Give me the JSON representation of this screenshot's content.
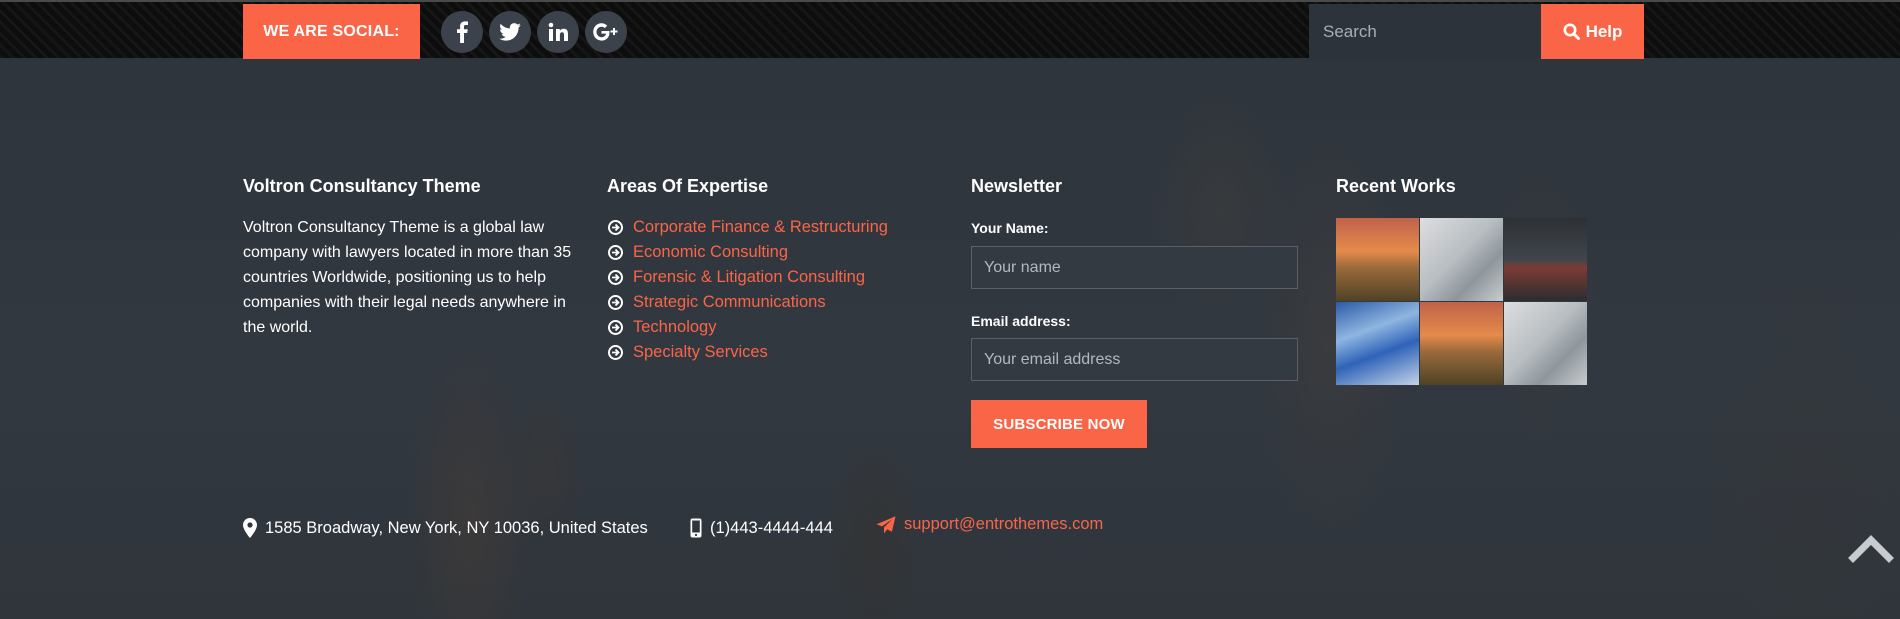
{
  "topbar": {
    "social_label": "WE ARE SOCIAL:",
    "social_links": [
      {
        "name": "facebook-icon",
        "glyph": "f"
      },
      {
        "name": "twitter-icon",
        "glyph": "t"
      },
      {
        "name": "linkedin-icon",
        "glyph": "in"
      },
      {
        "name": "google-plus-icon",
        "glyph": "G+"
      }
    ],
    "search_placeholder": "Search",
    "help_label": "Help"
  },
  "about": {
    "title": "Voltron Consultancy Theme",
    "text": "Voltron Consultancy Theme is a global law company with lawyers located in more than 35 countries Worldwide, positioning us to help companies with their legal needs anywhere in the world."
  },
  "expertise": {
    "title": "Areas Of Expertise",
    "items": [
      "Corporate Finance & Restructuring",
      "Economic Consulting",
      "Forensic & Litigation Consulting",
      "Strategic Communications",
      "Technology",
      "Specialty Services"
    ]
  },
  "newsletter": {
    "title": "Newsletter",
    "name_label": "Your Name:",
    "name_placeholder": "Your name",
    "email_label": "Email address:",
    "email_placeholder": "Your email address",
    "subscribe_label": "SUBSCRIBE NOW"
  },
  "recent_works": {
    "title": "Recent Works"
  },
  "contact": {
    "address": "1585 Broadway, New York, NY 10036, United States",
    "phone": "(1)443-4444-444",
    "email": "support@entrothemes.com"
  },
  "colors": {
    "accent": "#fa6548",
    "background": "#2f353d",
    "topbar": "#0d0d0d"
  }
}
